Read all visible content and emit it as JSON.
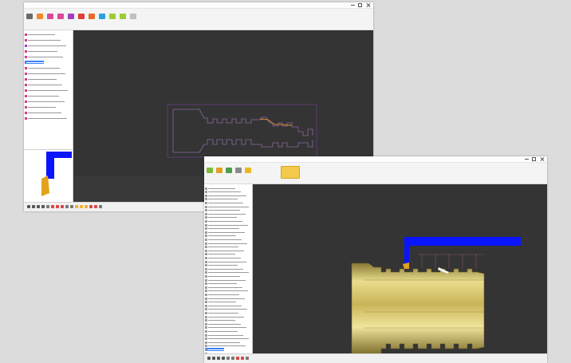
{
  "windows": [
    {
      "id": "program-window-2d",
      "ribbon_colors": [
        "#6a6a6a",
        "#f08a2a",
        "#d94a9a",
        "#d94a9a",
        "#a040c0",
        "#e03c3c",
        "#e86a2a",
        "#2aa0e0",
        "#9acd32",
        "#9acd32",
        "#c0c0c0"
      ],
      "tree_colors": [
        "#d43c8c",
        "#d43c8c",
        "#a040c0",
        "#d43c8c",
        "#d43c8c",
        "#a040c0",
        "#d43c8c",
        "#d43c8c",
        "#d43c8c",
        "#d43c8c",
        "#d43c8c",
        "#d43c8c",
        "#d43c8c",
        "#d43c8c",
        "#d43c8c",
        "#d43c8c"
      ],
      "selected_row": 5,
      "status_colors": [
        "#555555",
        "#555555",
        "#555555",
        "#555555",
        "#777777",
        "#d64545",
        "#d64545",
        "#d64545",
        "#777777",
        "#777777",
        "#f0b030",
        "#f0b030",
        "#f0b030",
        "#d64545",
        "#d64545",
        "#777777"
      ]
    },
    {
      "id": "simulation-window-3d",
      "ribbon_colors": [
        "#7dbb3a",
        "#e0a020",
        "#4aa04a",
        "#8a8a8a",
        "#e8b820"
      ],
      "status_colors": [
        "#555555",
        "#555555",
        "#555555",
        "#555555",
        "#777777",
        "#777777",
        "#d64545",
        "#d64545",
        "#777777"
      ]
    }
  ],
  "colors": {
    "viewport_bg": "#343434",
    "tool_blue": "#0a14ff",
    "part_gold": "#d9c562",
    "toolpath_line": "#6a3e8a",
    "selection": "#3b82f6"
  }
}
